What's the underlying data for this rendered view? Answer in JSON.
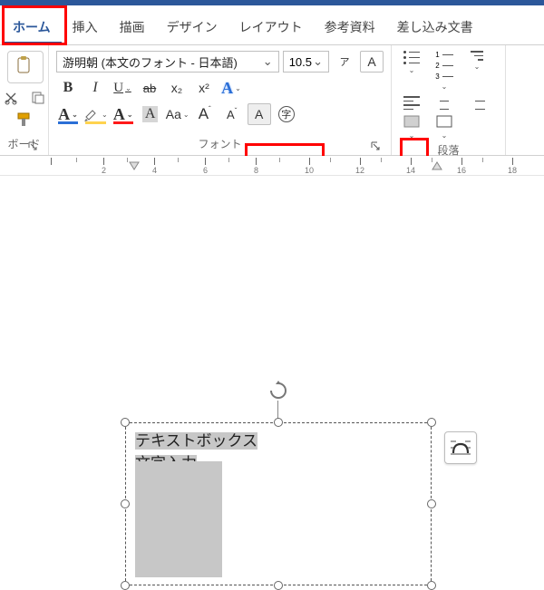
{
  "tabs": {
    "home": "ホーム",
    "insert": "挿入",
    "draw": "描画",
    "design": "デザイン",
    "layout": "レイアウト",
    "references": "参考資料",
    "mailings": "差し込み文書"
  },
  "font": {
    "name": "游明朝 (本文のフォント - 日本語)",
    "size": "10.5",
    "group_label": "フォント",
    "bold": "B",
    "italic": "I",
    "underline": "U",
    "strike": "ab",
    "sub": "x₂",
    "sup": "x²",
    "glyph_A": "A",
    "aa": "Aa",
    "grow": "A",
    "shrink": "A",
    "ruby": "ア",
    "charbox": "A",
    "enclosed": "㊧"
  },
  "clipboard": {
    "label": "ボード"
  },
  "paragraph": {
    "label": "段落"
  },
  "ruler": {
    "unit": 2,
    "start": 0,
    "count": 9
  },
  "textbox": {
    "line1": "テキストボックス",
    "line2": "文字入力"
  },
  "icons": {
    "launcher": "↘",
    "chev": "⌄",
    "clear_format": "A"
  },
  "highlight_color": "#ff0000",
  "underline_color_red": "#ff1a1a",
  "underline_color_yellow": "#ffd34f",
  "underline_color_blue": "#2b6fd6",
  "underline_color_gray": "#9aa0a6"
}
